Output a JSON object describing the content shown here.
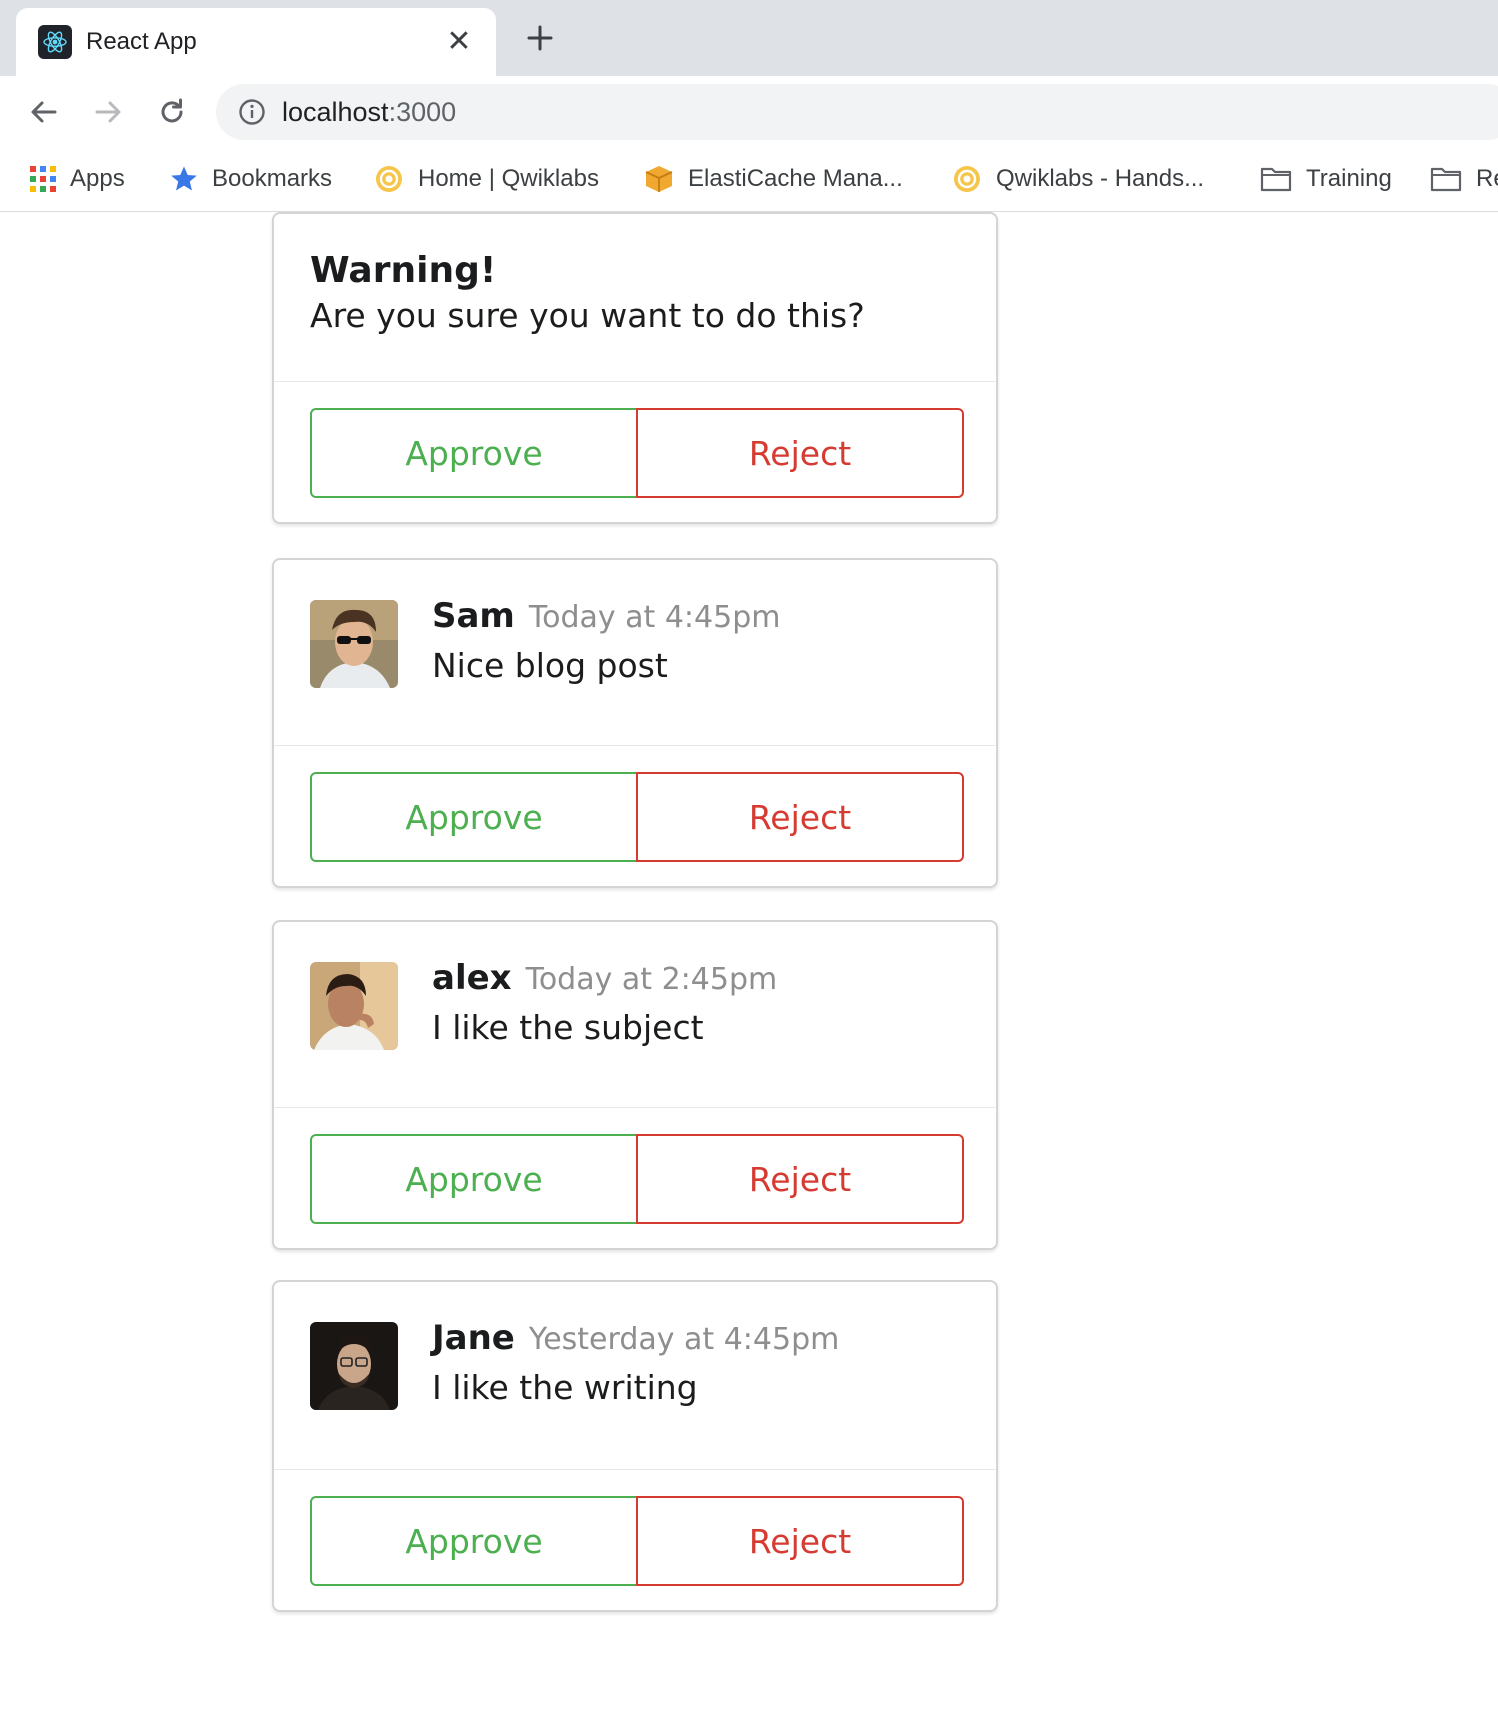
{
  "browser": {
    "tab_title": "React App",
    "url_host": "localhost",
    "url_port": ":3000",
    "bookmarks": [
      {
        "label": "Apps",
        "icon": "apps-grid-icon"
      },
      {
        "label": "Bookmarks",
        "icon": "star-icon"
      },
      {
        "label": "Home | Qwiklabs",
        "icon": "qwiklabs-icon"
      },
      {
        "label": "ElastiCache Mana...",
        "icon": "aws-box-icon"
      },
      {
        "label": "Qwiklabs - Hands...",
        "icon": "qwiklabs-icon"
      },
      {
        "label": "Training",
        "icon": "folder-icon"
      },
      {
        "label": "Re",
        "icon": "folder-icon"
      }
    ]
  },
  "warning_card": {
    "title": "Warning!",
    "text": "Are you sure you want to do this?",
    "approve_label": "Approve",
    "reject_label": "Reject"
  },
  "comments": [
    {
      "author": "Sam",
      "time": "Today at 4:45pm",
      "text": "Nice blog post",
      "approve_label": "Approve",
      "reject_label": "Reject"
    },
    {
      "author": "alex",
      "time": "Today at 2:45pm",
      "text": "I like the subject",
      "approve_label": "Approve",
      "reject_label": "Reject"
    },
    {
      "author": "Jane",
      "time": "Yesterday at 4:45pm",
      "text": "I like the writing",
      "approve_label": "Approve",
      "reject_label": "Reject"
    }
  ],
  "colors": {
    "approve": "#4caf50",
    "reject": "#d53b31",
    "meta": "#8e8e8e",
    "react_logo": "#61dafb"
  }
}
